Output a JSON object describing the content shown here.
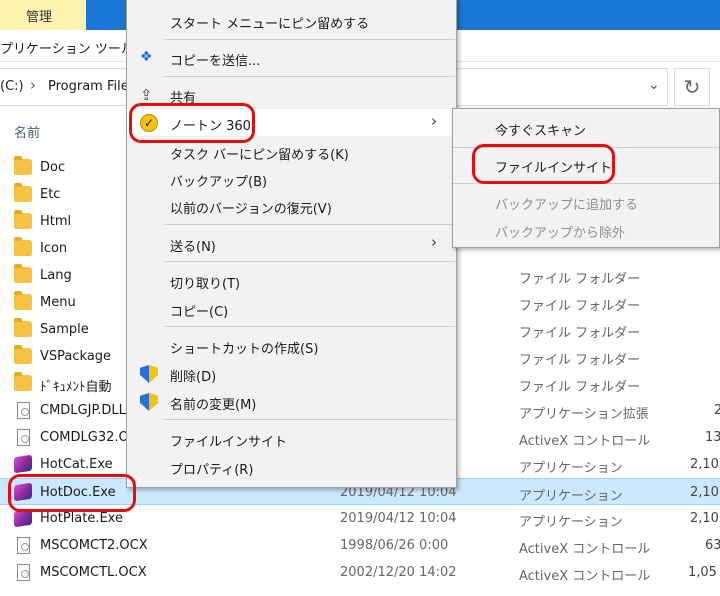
{
  "ribbon": {
    "manage_tab": "管理",
    "app_tools": "プリケーション ツール"
  },
  "address": {
    "drive": "(C:)",
    "crumb": "Program File",
    "refresh_icon": "refresh-icon"
  },
  "columns": {
    "name": "名前"
  },
  "files": [
    {
      "name": "Doc",
      "type": "",
      "date": "",
      "size": "",
      "icon": "folder"
    },
    {
      "name": "Etc",
      "type": "",
      "date": "",
      "size": "",
      "icon": "folder"
    },
    {
      "name": "Html",
      "type": "",
      "date": "",
      "size": "",
      "icon": "folder"
    },
    {
      "name": "Icon",
      "type": "",
      "date": "",
      "size": "",
      "icon": "folder"
    },
    {
      "name": "Lang",
      "type": "ファイル フォルダー",
      "date": "",
      "size": "",
      "icon": "folder"
    },
    {
      "name": "Menu",
      "type": "ファイル フォルダー",
      "date": "",
      "size": "",
      "icon": "folder"
    },
    {
      "name": "Sample",
      "type": "ファイル フォルダー",
      "date": "",
      "size": "",
      "icon": "folder"
    },
    {
      "name": "VSPackage",
      "type": "ファイル フォルダー",
      "date": "",
      "size": "",
      "icon": "folder"
    },
    {
      "name": "ﾄﾞｷｭﾒﾝﾄ自動",
      "type": "ファイル フォルダー",
      "date": "",
      "size": "",
      "icon": "folder"
    },
    {
      "name": "CMDLGJP.DLL",
      "type": "アプリケーション拡張",
      "date": "",
      "size": "2",
      "icon": "file"
    },
    {
      "name": "COMDLG32.O",
      "type": "ActiveX コントロール",
      "date": "",
      "size": "13",
      "icon": "file"
    },
    {
      "name": "HotCat.Exe",
      "type": "アプリケーション",
      "date": "",
      "size": "2,10",
      "icon": "app"
    },
    {
      "name": "HotDoc.Exe",
      "type": "アプリケーション",
      "date": "2019/04/12 10:04",
      "size": "2,10",
      "icon": "app"
    },
    {
      "name": "HotPlate.Exe",
      "type": "アプリケーション",
      "date": "2019/04/12 10:04",
      "size": "2,10",
      "icon": "app"
    },
    {
      "name": "MSCOMCT2.OCX",
      "type": "ActiveX コントロール",
      "date": "1998/06/26 0:00",
      "size": "63",
      "icon": "file"
    },
    {
      "name": "MSCOMCTL.OCX",
      "type": "ActiveX コントロール",
      "date": "2002/12/20 14:02",
      "size": "1,05",
      "icon": "file"
    }
  ],
  "context_menu": {
    "pin_start": "スタート メニューにピン留めする",
    "send_copy": "コピーを送信...",
    "share": "共有",
    "norton": "ノートン 360",
    "pin_taskbar": "タスク バーにピン留めする(K)",
    "backup": "バックアップ(B)",
    "restore": "以前のバージョンの復元(V)",
    "send_to": "送る(N)",
    "cut": "切り取り(T)",
    "copy": "コピー(C)",
    "shortcut": "ショートカットの作成(S)",
    "delete": "削除(D)",
    "rename": "名前の変更(M)",
    "file_insight": "ファイルインサイト",
    "properties": "プロパティ(R)"
  },
  "norton_submenu": {
    "scan_now": "今すぐスキャン",
    "file_insight": "ファイルインサイト",
    "add_backup": "バックアップに追加する",
    "remove_backup": "バックアップから除外"
  },
  "colors": {
    "highlight": "#e01010",
    "selection": "#cce8ff",
    "ribbon": "#1976d2"
  }
}
